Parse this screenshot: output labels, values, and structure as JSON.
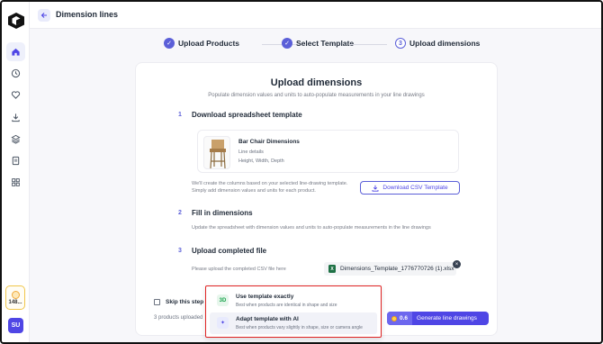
{
  "header": {
    "title": "Dimension lines"
  },
  "sidebar": {
    "items": [
      {
        "icon": "home-icon",
        "active": true
      },
      {
        "icon": "clock-icon",
        "active": false
      },
      {
        "icon": "heart-icon",
        "active": false
      },
      {
        "icon": "download-icon",
        "active": false
      },
      {
        "icon": "layers-icon",
        "active": false
      },
      {
        "icon": "document-icon",
        "active": false
      },
      {
        "icon": "grid-icon",
        "active": false
      }
    ],
    "credits": "148...",
    "avatar_initials": "SU"
  },
  "stepper": {
    "steps": [
      {
        "label": "Upload Products",
        "state": "done",
        "marker": "✓"
      },
      {
        "label": "Select Template",
        "state": "done",
        "marker": "✓"
      },
      {
        "label": "Upload dimensions",
        "state": "current",
        "marker": "3"
      }
    ]
  },
  "card": {
    "title": "Upload dimensions",
    "subtitle": "Populate dimension values and units to auto-populate measurements in your line drawings",
    "section1": {
      "number": "1",
      "title": "Download spreadsheet template",
      "template_name": "Bar Chair Dimensions",
      "template_type": "Line details",
      "template_fields": "Height, Width, Depth",
      "desc_line1": "We'll create the columns based on your selected line-drawing template.",
      "desc_line2": "Simply add dimension values and units for each product.",
      "button_label": "Download CSV Template"
    },
    "section2": {
      "number": "2",
      "title": "Fill in dimensions",
      "desc": "Update the spreadsheet with dimension values and units to auto-populate measurements in the line drawings"
    },
    "section3": {
      "number": "3",
      "title": "Upload completed file",
      "desc": "Please upload the completed CSV file here",
      "file_name": "Dimensions_Template_1776770726 (1).xlsx"
    },
    "skip_label": "Skip this step",
    "skip_hint": "(W",
    "uploaded_text": "3 products uploaded",
    "generate": {
      "cost": "0.6",
      "label": "Generate line drawings"
    }
  },
  "popup": {
    "options": [
      {
        "title": "Use template exactly",
        "desc": "Best when products are identical in shape and size",
        "icon": "exact-template-icon",
        "glyph": "3D"
      },
      {
        "title": "Adapt template with AI",
        "desc": "Best when products vary slightly in shape, size or camera angle",
        "icon": "sparkle-icon",
        "glyph": "✦"
      }
    ]
  },
  "colors": {
    "accent": "#4f46e5",
    "highlight_border": "#e02424",
    "excel_green": "#1e7145"
  }
}
